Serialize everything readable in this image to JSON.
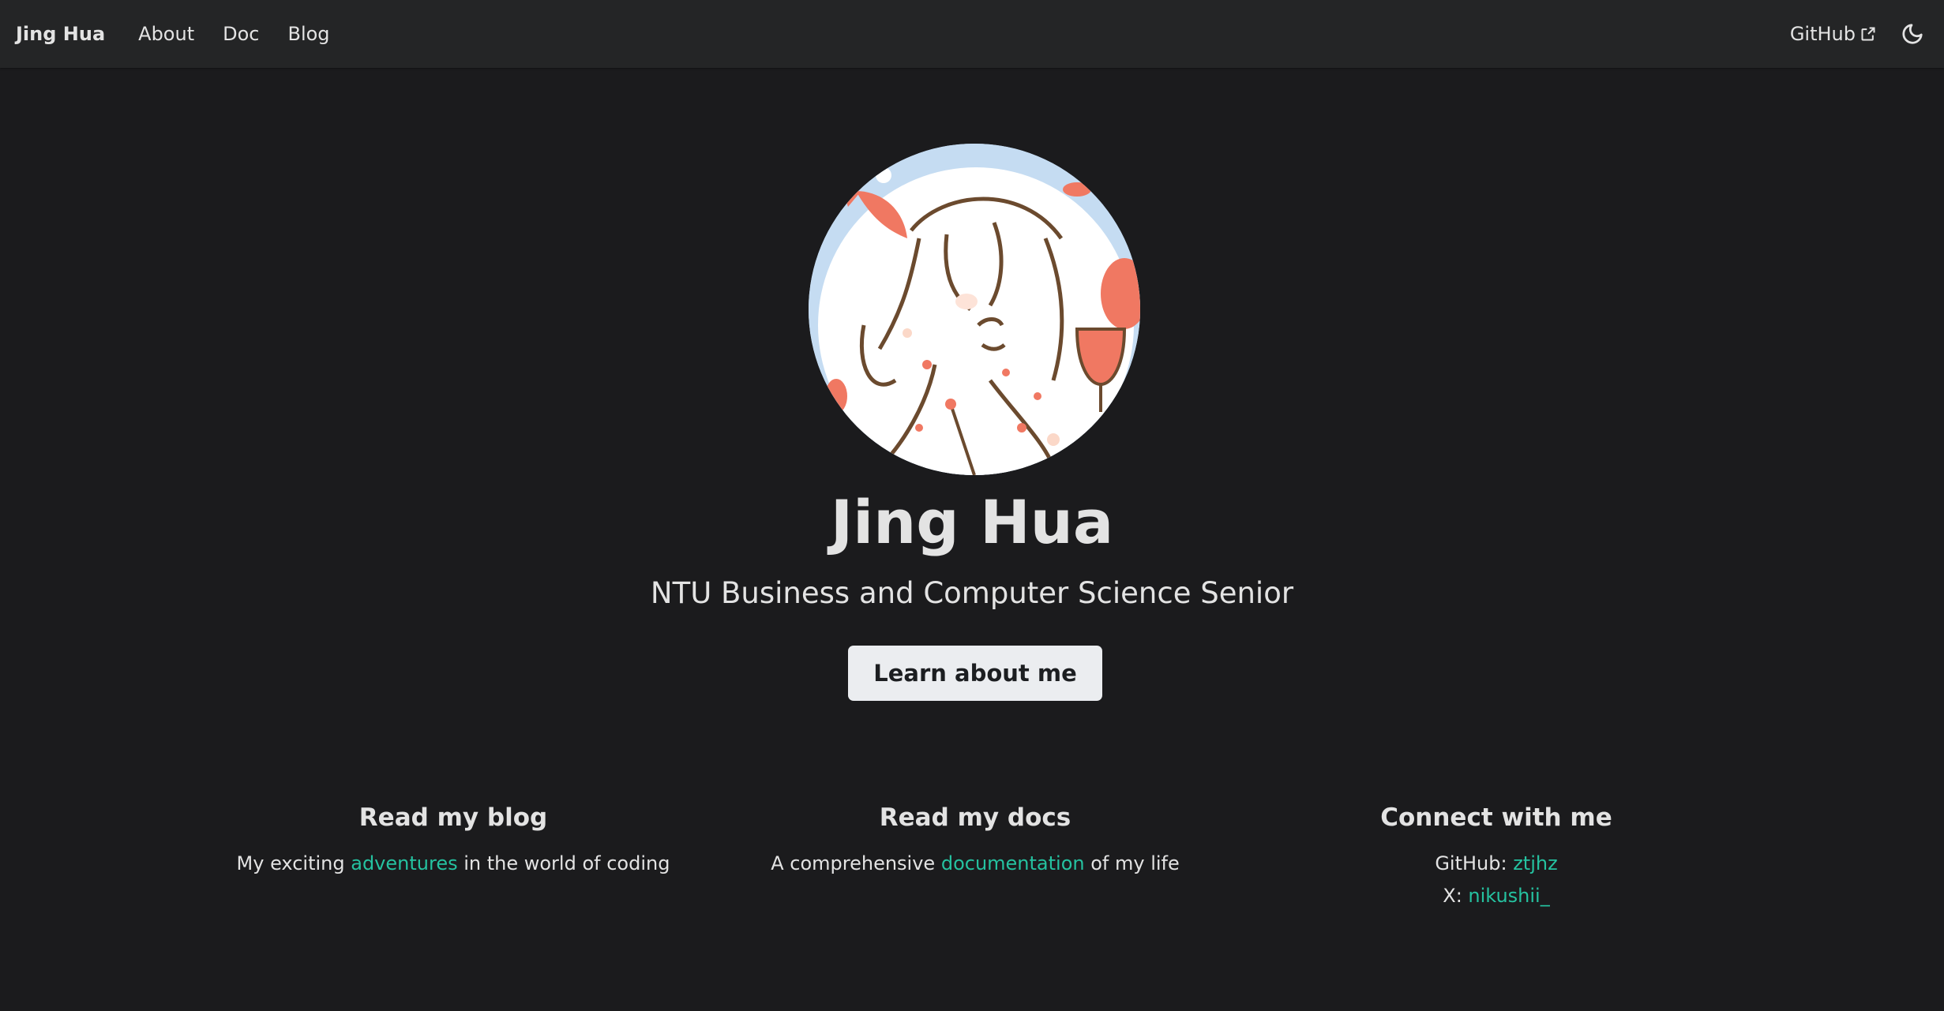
{
  "navbar": {
    "brand": "Jing Hua",
    "links": [
      "About",
      "Doc",
      "Blog"
    ],
    "github_label": "GitHub",
    "theme_icon": "moon-icon",
    "external_icon": "external-link-icon"
  },
  "hero": {
    "title": "Jing Hua",
    "subtitle": "NTU Business and Computer Science Senior",
    "cta_label": "Learn about me"
  },
  "features": [
    {
      "title": "Read my blog",
      "text_before": "My exciting ",
      "link_text": "adventures",
      "text_after": " in the world of coding"
    },
    {
      "title": "Read my docs",
      "text_before": "A comprehensive ",
      "link_text": "documentation",
      "text_after": " of my life"
    },
    {
      "title": "Connect with me",
      "github_label": "GitHub: ",
      "github_handle": "ztjhz",
      "x_label": "X: ",
      "x_handle": "nikushii_"
    }
  ],
  "colors": {
    "background": "#1b1b1d",
    "navbar": "#242526",
    "link_accent": "#25c2a0",
    "button_bg": "#ebedf0"
  }
}
